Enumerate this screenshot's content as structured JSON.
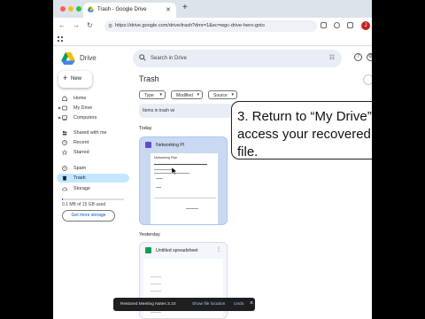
{
  "browser": {
    "tab_title": "Trash - Google Drive",
    "new_tab_symbol": "+",
    "url": "https://drive.google.com/drive/trash?dmr=1&ec=wgc-drive-hero-goto",
    "profile_initial": "J"
  },
  "header": {
    "product": "Drive",
    "search_placeholder": "Search in Drive"
  },
  "sidebar": {
    "new_label": "New",
    "items": [
      {
        "label": "Home",
        "icon": "home-icon"
      },
      {
        "label": "My Drive",
        "icon": "my-drive-icon"
      },
      {
        "label": "Computers",
        "icon": "computer-icon"
      },
      {
        "label": "Shared with me",
        "icon": "shared-icon"
      },
      {
        "label": "Recent",
        "icon": "clock-icon"
      },
      {
        "label": "Starred",
        "icon": "star-icon"
      },
      {
        "label": "Spam",
        "icon": "spam-icon"
      },
      {
        "label": "Trash",
        "icon": "trash-icon"
      },
      {
        "label": "Storage",
        "icon": "cloud-icon"
      }
    ],
    "storage_used_text": "0.1 MB of 15 GB used",
    "storage_fraction": 1e-05,
    "get_storage_label": "Get more storage"
  },
  "main": {
    "title": "Trash",
    "filters": [
      "Type",
      "Modified",
      "Source"
    ],
    "banner_text": "Items in trash wi",
    "sections": [
      {
        "label": "Today",
        "file": {
          "name": "Networking Pl",
          "thumb_title": "Networking Plan"
        }
      },
      {
        "label": "Yesterday",
        "file": {
          "name": "Untitled spreadsheet"
        }
      }
    ]
  },
  "callout": {
    "text": "3. Return to “My Drive” to access your recovered file."
  },
  "snackbar": {
    "message": "Restored Meeting Notes 3.10",
    "action_show": "Show file location",
    "action_undo": "Undo",
    "close_symbol": "×"
  },
  "colors": {
    "active_nav": "#c2e7ff",
    "docs_blue": "#4285f4",
    "sheets_green": "#0f9d58",
    "docs_purple": "#5f4bd6"
  }
}
